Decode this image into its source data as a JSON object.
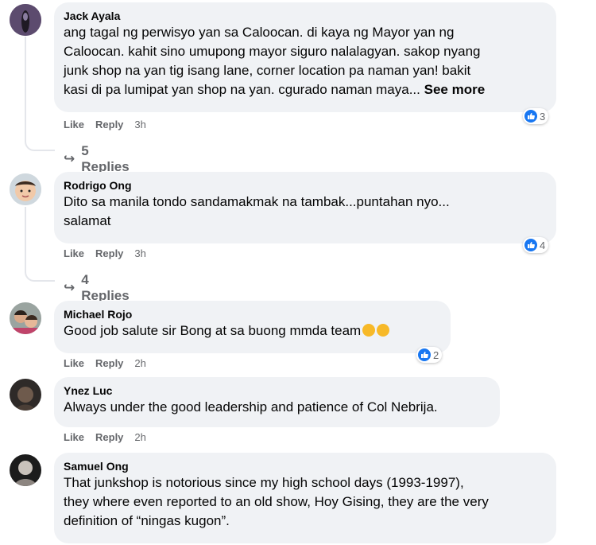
{
  "comments": [
    {
      "author": "Jack Ayala",
      "lines": [
        "ang tagal ng perwisyo yan sa Caloocan. di kaya ng Mayor yan ng",
        "Caloocan. kahit sino umupong mayor siguro nalalagyan. sakop nyang",
        "junk shop na yan tig isang lane, corner location pa naman yan! bakit",
        "kasi di pa lumipat yan shop na yan. cgurado naman maya..."
      ],
      "see_more": "See more",
      "like": "Like",
      "reply": "Reply",
      "time": "3h",
      "reactions": "3",
      "replies": "5 Replies"
    },
    {
      "author": "Rodrigo Ong",
      "lines": [
        "Dito sa manila tondo sandamakmak na tambak...puntahan nyo...",
        "salamat"
      ],
      "like": "Like",
      "reply": "Reply",
      "time": "3h",
      "reactions": "4",
      "replies": "4 Replies"
    },
    {
      "author": "Michael Rojo",
      "lines": [
        "Good job salute sir Bong at sa buong mmda team"
      ],
      "emoji": [
        "thumbs-up",
        "clap"
      ],
      "like": "Like",
      "reply": "Reply",
      "time": "2h",
      "reactions": "2"
    },
    {
      "author": "Ynez Luc",
      "lines": [
        "Always under the good leadership and patience of Col Nebrija."
      ],
      "like": "Like",
      "reply": "Reply",
      "time": "2h"
    },
    {
      "author": "Samuel Ong",
      "lines": [
        "That junkshop is notorious since my high school days (1993-1997),",
        "they where even reported to an old show, Hoy Gising, they are the very",
        "definition of “ningas kugon”."
      ]
    }
  ],
  "colors": {
    "bubble": "#f0f2f5",
    "meta": "#65676b",
    "like": "#1877f2"
  }
}
